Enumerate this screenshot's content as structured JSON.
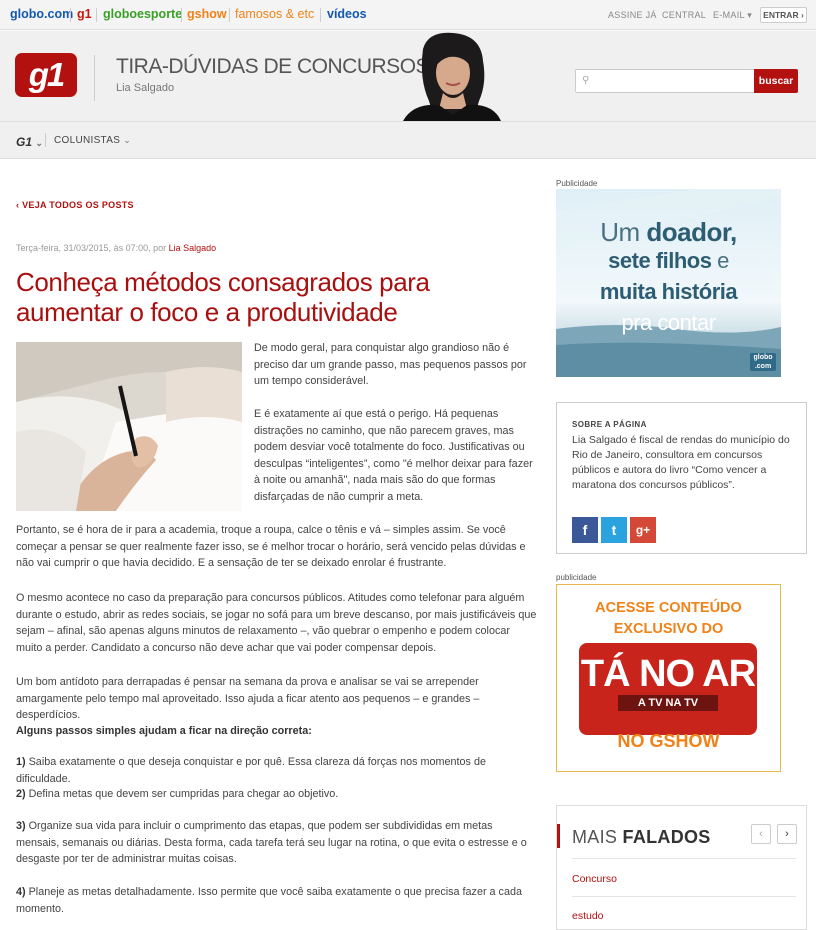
{
  "topbar": {
    "links": [
      {
        "label": "globo.com",
        "color": "#1458b0"
      },
      {
        "label": "g1",
        "color": "#c4170c"
      },
      {
        "label": "globoesporte",
        "color": "#39a025"
      },
      {
        "label": "gshow",
        "color": "#f08218"
      },
      {
        "label": "famosos & etc",
        "color": "#f08218"
      },
      {
        "label": "vídeos",
        "color": "#1458b0"
      }
    ],
    "assine": "ASSINE JÁ",
    "central": "CENTRAL",
    "email": "E-MAIL",
    "entrar": "ENTRAR"
  },
  "header": {
    "logo": "g1",
    "blog_title": "TIRA-DÚVIDAS DE CONCURSOS",
    "author": "Lia Salgado",
    "search_placeholder": "",
    "search_button": "buscar"
  },
  "nav": {
    "g1": "G1",
    "colunistas": "COLUNISTAS"
  },
  "article": {
    "back": "VEJA TODOS OS POSTS",
    "meta_date": "Terça-feira, 31/03/2015, às 07:00, por ",
    "meta_author": "Lia Salgado",
    "title": "Conheça métodos consagrados para aumentar o foco e a produtividade",
    "p1": "De modo geral, para conquistar algo grandioso não é preciso dar um grande passo, mas pequenos passos por um tempo considerável.",
    "p2": "E é exatamente aí que está o perigo. Há pequenas distrações no caminho, que não parecem graves, mas podem desviar você totalmente do foco. Justificativas ou desculpas “inteligentes”, como \"é melhor deixar para fazer à noite ou amanhã\", nada mais são do que formas disfarçadas de não cumprir a meta.",
    "p3": "Portanto, se é hora de ir para a academia, troque a roupa, calce o tênis e vá – simples assim. Se você começar a pensar se quer realmente fazer isso, se é melhor trocar o horário, será vencido pelas dúvidas e não vai cumprir o que havia decidido. E a sensação de ter se deixado enrolar é frustrante.",
    "p4": "O mesmo acontece no caso da preparação para concursos públicos. Atitudes como telefonar para alguém durante o estudo, abrir as redes sociais, se jogar no sofá para um breve descanso, por mais justificáveis que sejam – afinal, são apenas alguns minutos de relaxamento –, vão quebrar o empenho e podem colocar muito a perder. Candidato a concurso não deve achar que vai poder compensar depois.",
    "p5": "Um bom antídoto para derrapadas é pensar na semana da prova e analisar se vai se arrepender amargamente pelo tempo mal aproveitado. Isso ajuda a ficar atento aos pequenos – e grandes – desperdícios.",
    "steps_heading": "Alguns passos simples ajudam a ficar na direção correta:",
    "s1n": "1)",
    "s1": " Saiba exatamente o que deseja conquistar e por quê. Essa clareza dá forças nos momentos de dificuldade.",
    "s2n": "2)",
    "s2": " Defina metas que devem ser cumpridas para chegar ao objetivo.",
    "s3n": "3)",
    "s3": " Organize sua vida para incluir o cumprimento das etapas, que podem ser subdivididas em metas mensais, semanais ou diárias. Desta forma, cada tarefa terá seu lugar na rotina, o que evita o estresse e o desgaste por ter de administrar muitas coisas.",
    "s4n": "4)",
    "s4": " Planeje as metas detalhadamente. Isso permite que você saiba exatamente o que precisa fazer a cada momento."
  },
  "sidebar": {
    "pub1": "Publicidade",
    "ad1_line1a": "Um ",
    "ad1_line1b": "doador,",
    "ad1_line2a": "sete filhos",
    "ad1_line2b": " e",
    "ad1_line3": "muita história",
    "ad1_line4": "pra contar",
    "ad1_badge1": "globo",
    "ad1_badge2": ".com",
    "about_heading": "SOBRE A PÁGINA",
    "about_text": "Lia Salgado é fiscal de rendas do município do Rio de Janeiro, consultora em concursos públicos e autora do livro “Como vencer a maratona dos concursos públicos”.",
    "social": [
      {
        "icon": "f",
        "name": "facebook",
        "color": "#3b5998"
      },
      {
        "icon": "t",
        "name": "twitter",
        "color": "#2aa3df"
      },
      {
        "icon": "g+",
        "name": "google-plus",
        "color": "#d34836"
      }
    ],
    "pub2": "publicidade",
    "ad2_l1": "ACESSE CONTEÚDO",
    "ad2_l2": "EXCLUSIVO DO",
    "ad2_l3": "TÁ NO AR",
    "ad2_l4": "A TV NA TV",
    "ad2_l5": "NO GSHOW",
    "mais_a": "MAIS ",
    "mais_b": "FALADOS",
    "prev": "‹",
    "next": "›",
    "items": [
      "Concurso",
      "estudo"
    ]
  }
}
